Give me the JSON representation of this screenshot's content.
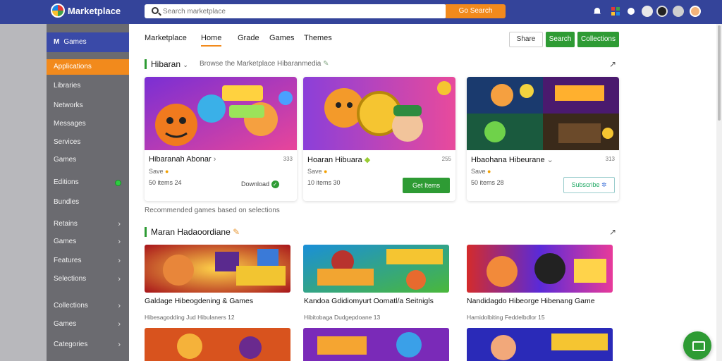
{
  "app": {
    "brand": "Marketplace"
  },
  "search": {
    "placeholder": "Search marketplace",
    "value": "",
    "button_label": "Go Search"
  },
  "colors": {
    "topbar": "#34449a",
    "accent": "#f28a1c",
    "green": "#2e9b34",
    "sidebar": "#6b6b70"
  },
  "topbar_icons": [
    "notification-icon",
    "apps-icon",
    "chat-icon",
    "profile-icon",
    "settings-icon",
    "user-avatar"
  ],
  "sidebar": {
    "header": "Games",
    "items": [
      {
        "label": "Applications",
        "active": true
      },
      {
        "label": "Libraries"
      },
      {
        "label": "Networks"
      },
      {
        "label": "Messages"
      },
      {
        "label": "Services"
      },
      {
        "label": "Games"
      },
      {
        "label": "Editions",
        "badge": "online"
      },
      {
        "label": "Bundles"
      },
      {
        "label": "Retains",
        "chevron": true
      },
      {
        "label": "Games",
        "chevron": true
      },
      {
        "label": "Features",
        "chevron": true
      },
      {
        "label": "Selections",
        "chevron": true
      },
      {
        "label": "Collections",
        "chevron": true
      },
      {
        "label": "Games",
        "chevron": true
      },
      {
        "label": "Categories",
        "chevron": true
      }
    ]
  },
  "tabs": [
    "Marketplace",
    "Home",
    "Grade",
    "Games",
    "Themes"
  ],
  "header_buttons": {
    "outline": "Share",
    "primary": "Search",
    "secondary": "Collections"
  },
  "section1": {
    "title": "Hibaran",
    "subtitle": "Browse the Marketplace Hibaranmedia",
    "cards": [
      {
        "title": "Hibaranah Abonar",
        "version": "333",
        "rating": "Save",
        "meta": "50 items 24",
        "action": "Download",
        "action_icon": "check-icon"
      },
      {
        "title": "Hoaran Hibuara",
        "version": "255",
        "rating": "Save",
        "meta": "10 items 30",
        "action": "Get Items"
      },
      {
        "title": "Hbaohana Hibeurane",
        "version": "313",
        "rating": "Save",
        "meta": "50 items 28",
        "action": "Subscribe"
      }
    ]
  },
  "note": "Recommended games based on selections",
  "section2": {
    "title": "Maran Hadaoordiane",
    "games": [
      {
        "title": "Galdage Hibeogdening & Games",
        "sub": "Hibesagodding Jud Hibulaners 12"
      },
      {
        "title": "Kandoa Gdidiomyurt Oomatl/a Seitnigls",
        "sub": "Hibitobaga Dudgepdoane 13"
      },
      {
        "title": "Nandidagdo Hibeorge Hibenang Game",
        "sub": "Hamidolbiting Feddelbdlor 15"
      }
    ]
  }
}
